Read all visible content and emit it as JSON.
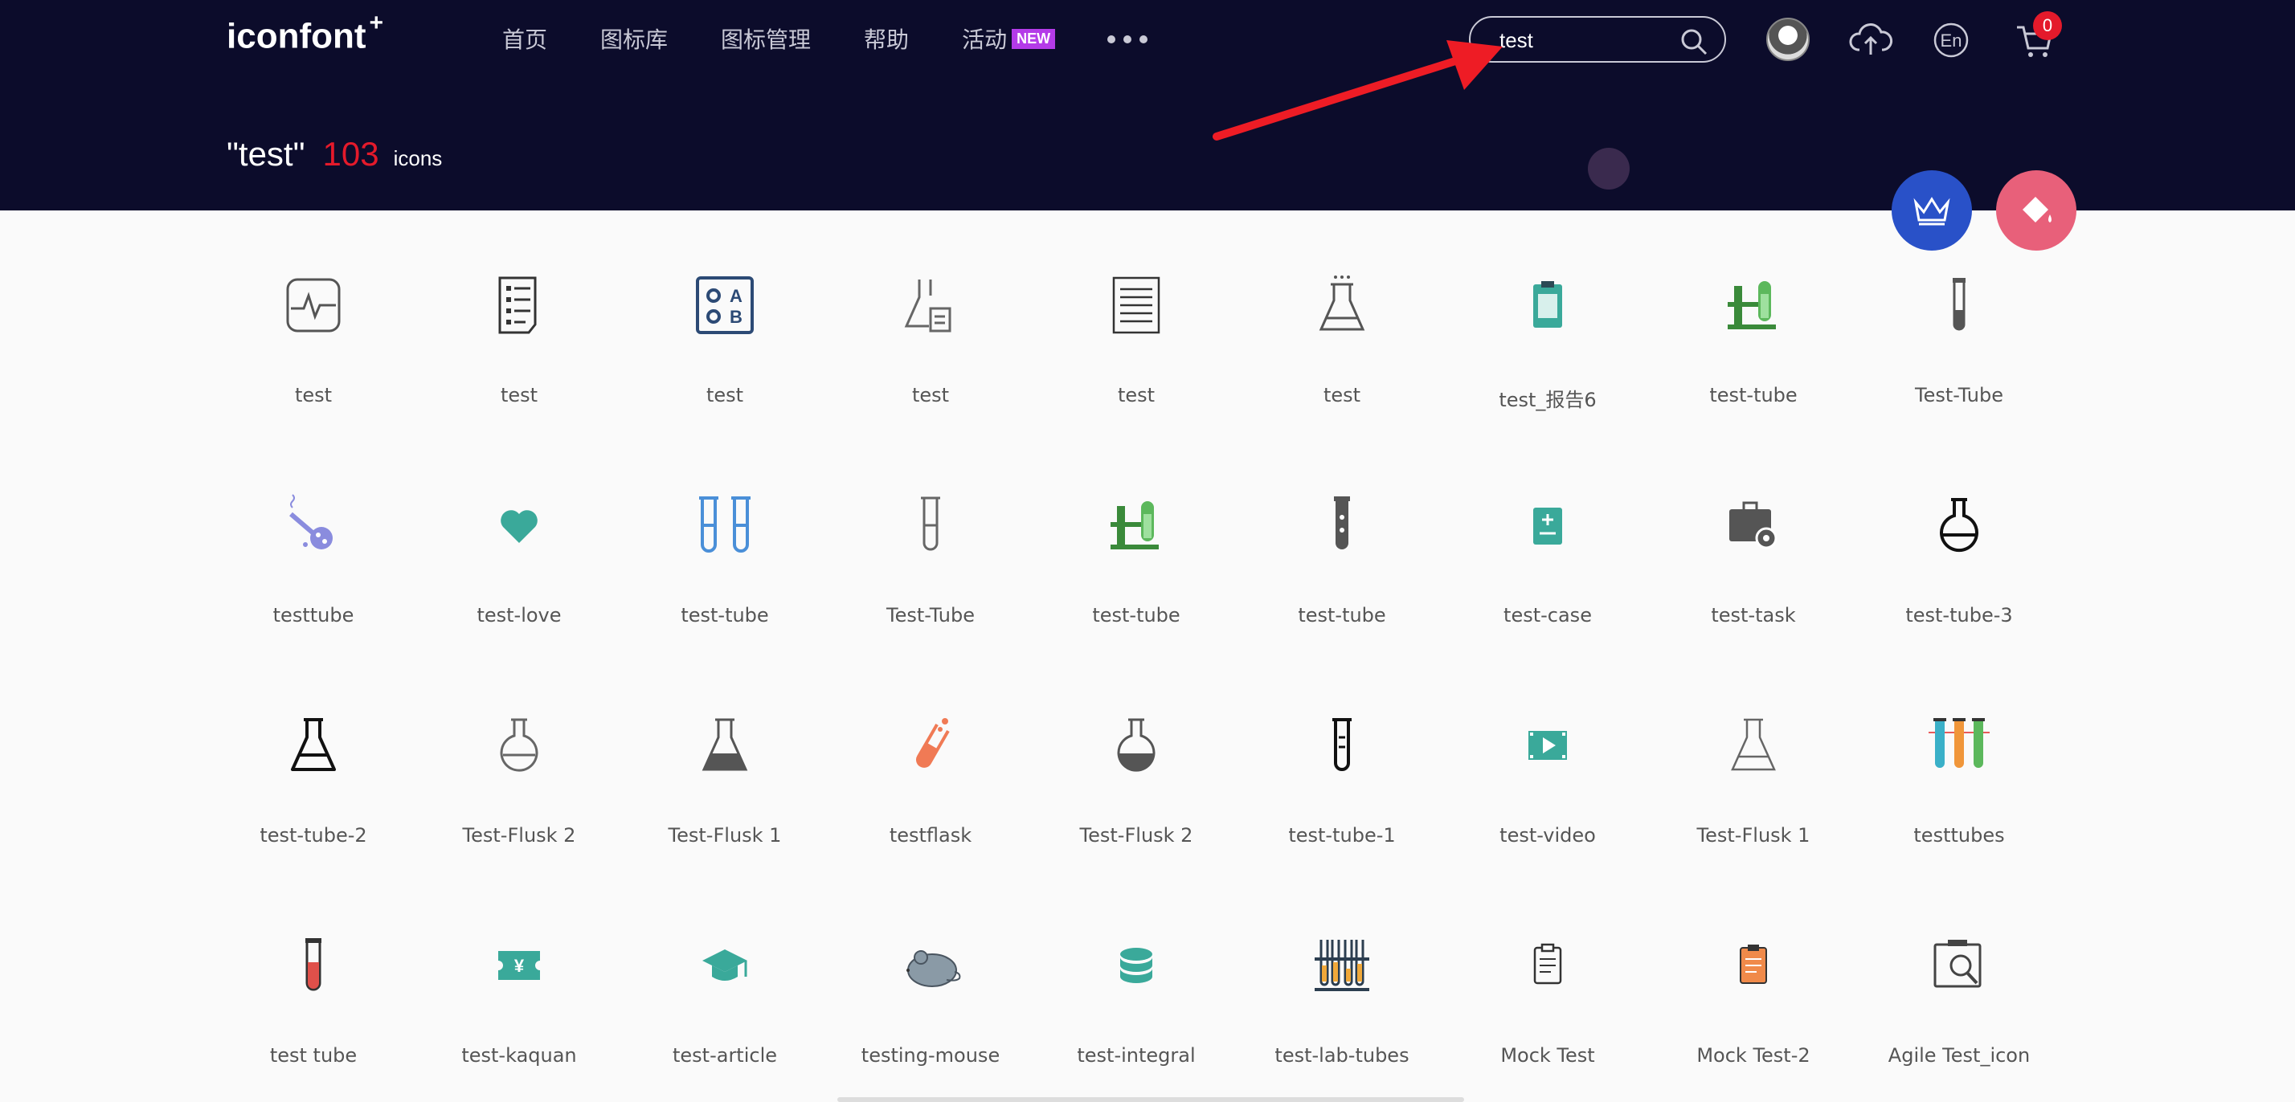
{
  "header": {
    "logo": "iconfont",
    "logo_plus": "+",
    "nav": [
      "首页",
      "图标库",
      "图标管理",
      "帮助",
      "活动"
    ],
    "nav_badge": "NEW",
    "search_value": "test",
    "cart_count": "0",
    "lang_label": "En"
  },
  "result": {
    "query": "\"test\"",
    "count": "103",
    "unit": "icons"
  },
  "colors": {
    "header_bg": "#0c0c2b",
    "count_red": "#e41a2b",
    "crown_blue": "#2951c8",
    "paint_pink": "#e8607a",
    "teal": "#3aa99a"
  },
  "icons": [
    {
      "label": "test",
      "icon": "monitor-pulse-icon"
    },
    {
      "label": "test",
      "icon": "checklist-icon"
    },
    {
      "label": "test",
      "icon": "abc-test-icon"
    },
    {
      "label": "test",
      "icon": "flask-doc-icon"
    },
    {
      "label": "test",
      "icon": "notepad-icon"
    },
    {
      "label": "test",
      "icon": "flask-icon"
    },
    {
      "label": "test_报告6",
      "icon": "clipboard-icon"
    },
    {
      "label": "test-tube",
      "icon": "green-tubes-icon"
    },
    {
      "label": "Test-Tube",
      "icon": "tube-icon"
    },
    {
      "label": "testtube",
      "icon": "purple-flask-icon"
    },
    {
      "label": "test-love",
      "icon": "heart-icon"
    },
    {
      "label": "test-tube",
      "icon": "blue-tubes-icon"
    },
    {
      "label": "Test-Tube",
      "icon": "tube-outline-icon"
    },
    {
      "label": "test-tube",
      "icon": "green-tubes-icon"
    },
    {
      "label": "test-tube",
      "icon": "dark-tube-icon"
    },
    {
      "label": "test-case",
      "icon": "teal-case-icon"
    },
    {
      "label": "test-task",
      "icon": "toolbox-gear-icon"
    },
    {
      "label": "test-tube-3",
      "icon": "round-flask-icon"
    },
    {
      "label": "test-tube-2",
      "icon": "erlenmeyer-icon"
    },
    {
      "label": "Test-Flusk 2",
      "icon": "round-flask-outline-icon"
    },
    {
      "label": "Test-Flusk 1",
      "icon": "erlenmeyer-filled-icon"
    },
    {
      "label": "testflask",
      "icon": "orange-tube-icon"
    },
    {
      "label": "Test-Flusk 2",
      "icon": "round-flask-filled-icon"
    },
    {
      "label": "test-tube-1",
      "icon": "tube-lines-icon"
    },
    {
      "label": "test-video",
      "icon": "video-icon"
    },
    {
      "label": "Test-Flusk 1",
      "icon": "erlenmeyer-outline-icon"
    },
    {
      "label": "testtubes",
      "icon": "colored-tubes-icon"
    },
    {
      "label": "test tube",
      "icon": "red-tube-icon"
    },
    {
      "label": "test-kaquan",
      "icon": "ticket-icon"
    },
    {
      "label": "test-article",
      "icon": "graduation-cap-icon"
    },
    {
      "label": "testing-mouse",
      "icon": "mouse-icon"
    },
    {
      "label": "test-integral",
      "icon": "coins-icon"
    },
    {
      "label": "test-lab-tubes",
      "icon": "tube-rack-icon"
    },
    {
      "label": "Mock Test",
      "icon": "clipboard-outline-icon"
    },
    {
      "label": "Mock Test-2",
      "icon": "orange-clipboard-icon"
    },
    {
      "label": "Agile Test_icon",
      "icon": "magnifier-board-icon"
    }
  ]
}
